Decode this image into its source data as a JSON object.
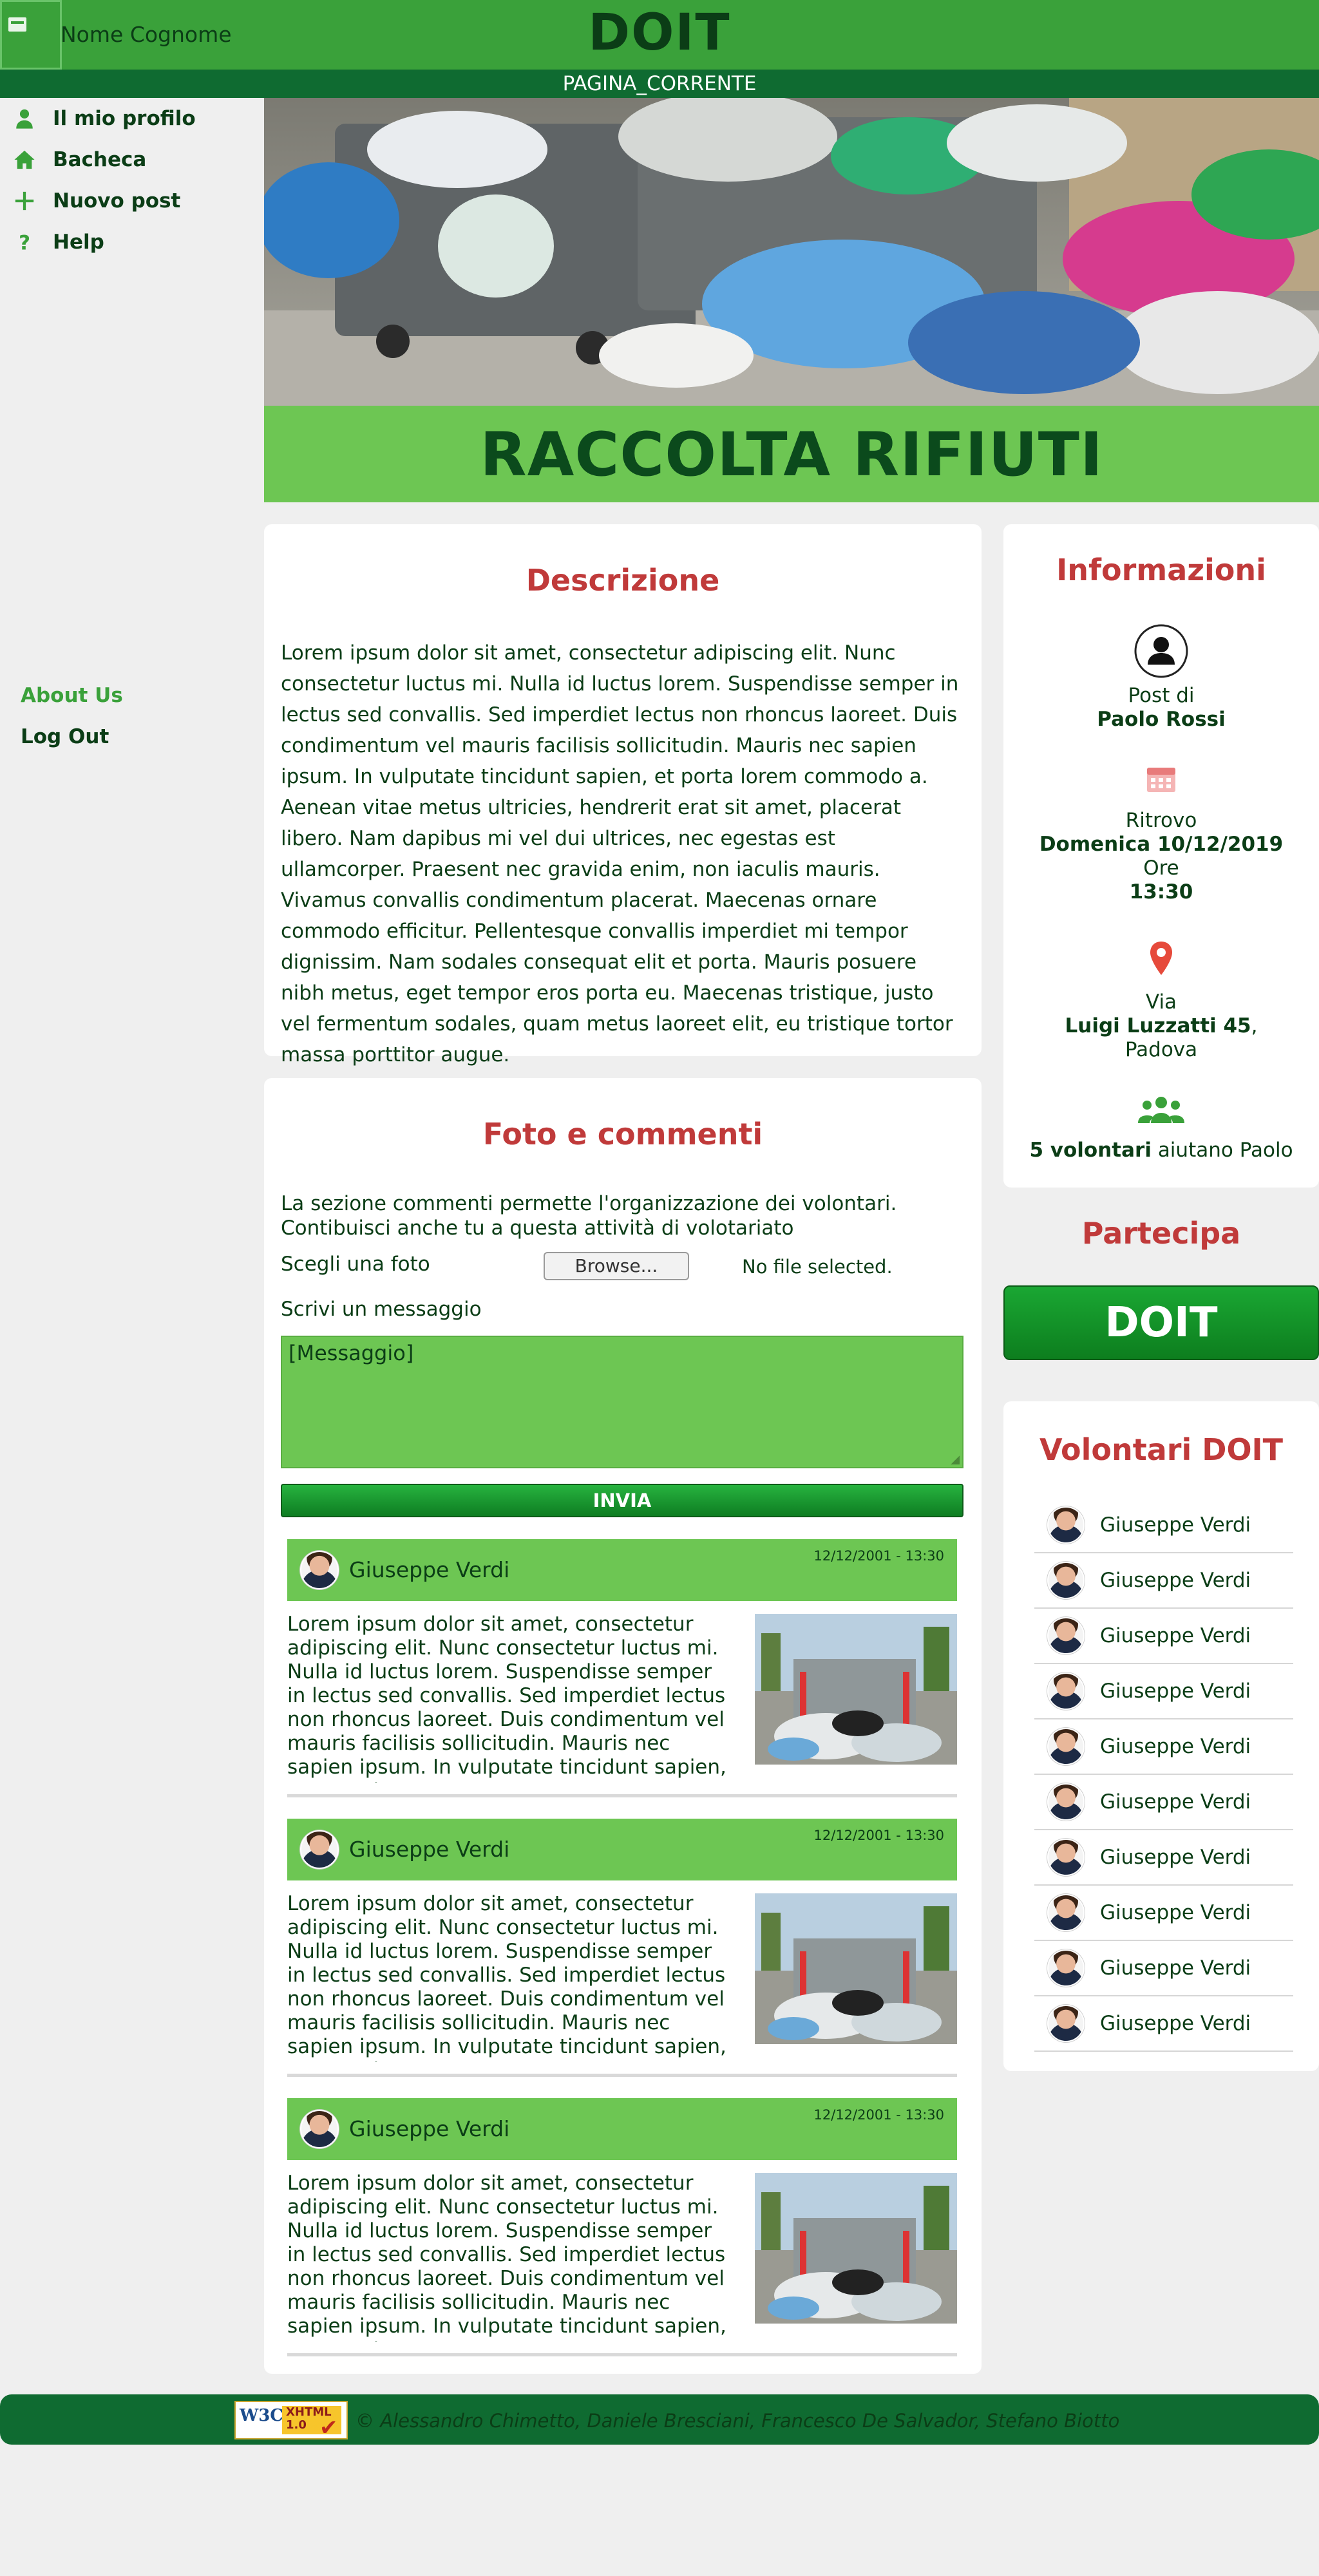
{
  "header": {
    "user_name": "Nome Cognome",
    "brand": "DOIT",
    "current_page": "PAGINA_CORRENTE"
  },
  "sidebar": {
    "items": [
      {
        "label": "Il mio profilo",
        "icon": "user-icon"
      },
      {
        "label": "Bacheca",
        "icon": "home-icon"
      },
      {
        "label": "Nuovo post",
        "icon": "plus-icon"
      },
      {
        "label": "Help",
        "icon": "question-icon"
      }
    ],
    "bottom": {
      "about": "About Us",
      "logout": "Log Out"
    }
  },
  "hero": {
    "title": "RACCOLTA RIFIUTI"
  },
  "description": {
    "title": "Descrizione",
    "text": "Lorem ipsum dolor sit amet, consectetur adipiscing elit. Nunc consectetur luctus mi. Nulla id luctus lorem. Suspendisse semper in lectus sed convallis. Sed imperdiet lectus non rhoncus laoreet. Duis condimentum vel mauris facilisis sollicitudin. Mauris nec sapien ipsum. In vulputate tincidunt sapien, et porta lorem commodo a. Aenean vitae metus ultricies, hendrerit erat sit amet, placerat libero. Nam dapibus mi vel dui ultrices, nec egestas est ullamcorper. Praesent nec gravida enim, non iaculis mauris. Vivamus convallis condimentum placerat. Maecenas ornare commodo efficitur. Pellentesque convallis imperdiet mi tempor dignissim. Nam sodales consequat elit et porta. Mauris posuere nibh metus, eget tempor eros porta eu. Maecenas tristique, justo vel fermentum sodales, quam metus laoreet elit, eu tristique tortor massa porttitor augue."
  },
  "info": {
    "title": "Informazioni",
    "post_by_label": "Post di",
    "post_by_name": "Paolo Rossi",
    "meet_label": "Ritrovo",
    "meet_date": "Domenica 10/12/2019",
    "time_label": "Ore",
    "time": "13:30",
    "place_label": "Via",
    "place_street": "Luigi Luzzatti 45",
    "place_city": "Padova",
    "volunteers_count": "5 volontari",
    "volunteers_suffix": "aiutano Paolo"
  },
  "join": {
    "title": "Partecipa",
    "button": "DOIT"
  },
  "volunteers": {
    "title": "Volontari DOIT",
    "names": [
      "Giuseppe Verdi",
      "Giuseppe Verdi",
      "Giuseppe Verdi",
      "Giuseppe Verdi",
      "Giuseppe Verdi",
      "Giuseppe Verdi",
      "Giuseppe Verdi",
      "Giuseppe Verdi",
      "Giuseppe Verdi",
      "Giuseppe Verdi"
    ]
  },
  "comments_section": {
    "title": "Foto e commenti",
    "intro": "La sezione commenti permette l'organizzazione dei volontari. Contibuisci anche tu a questa attività di volotariato",
    "photo_label": "Scegli una foto",
    "browse_label": "Browse...",
    "no_file": "No file selected.",
    "message_label": "Scrivi un messaggio",
    "message_placeholder": "[Messaggio]",
    "send_label": "INVIA",
    "comments": [
      {
        "author": "Giuseppe Verdi",
        "date": "12/12/2001 - 13:30",
        "text": "Lorem ipsum dolor sit amet, consectetur adipiscing elit. Nunc consectetur luctus mi. Nulla id luctus lorem. Suspendisse semper in lectus sed convallis. Sed imperdiet lectus non rhoncus laoreet. Duis condimentum vel mauris facilisis sollicitudin. Mauris nec sapien ipsum. In vulputate tincidunt sapien, et porta lorem co"
      },
      {
        "author": "Giuseppe Verdi",
        "date": "12/12/2001 - 13:30",
        "text": "Lorem ipsum dolor sit amet, consectetur adipiscing elit. Nunc consectetur luctus mi. Nulla id luctus lorem. Suspendisse semper in lectus sed convallis. Sed imperdiet lectus non rhoncus laoreet. Duis condimentum vel mauris facilisis sollicitudin. Mauris nec sapien ipsum. In vulputate tincidunt sapien, et porta lorem co"
      },
      {
        "author": "Giuseppe Verdi",
        "date": "12/12/2001 - 13:30",
        "text": "Lorem ipsum dolor sit amet, consectetur adipiscing elit. Nunc consectetur luctus mi. Nulla id luctus lorem. Suspendisse semper in lectus sed convallis. Sed imperdiet lectus non rhoncus laoreet. Duis condimentum vel mauris facilisis sollicitudin. Mauris nec sapien ipsum. In vulputate tincidunt sapien, et porta lorem co"
      }
    ]
  },
  "footer": {
    "badge_w3c": "W3C",
    "badge_xhtml": "XHTML",
    "badge_version": "1.0",
    "credits": "© Alessandro Chimetto, Daniele Bresciani, Francesco De Salvador, Stefano Biotto"
  }
}
